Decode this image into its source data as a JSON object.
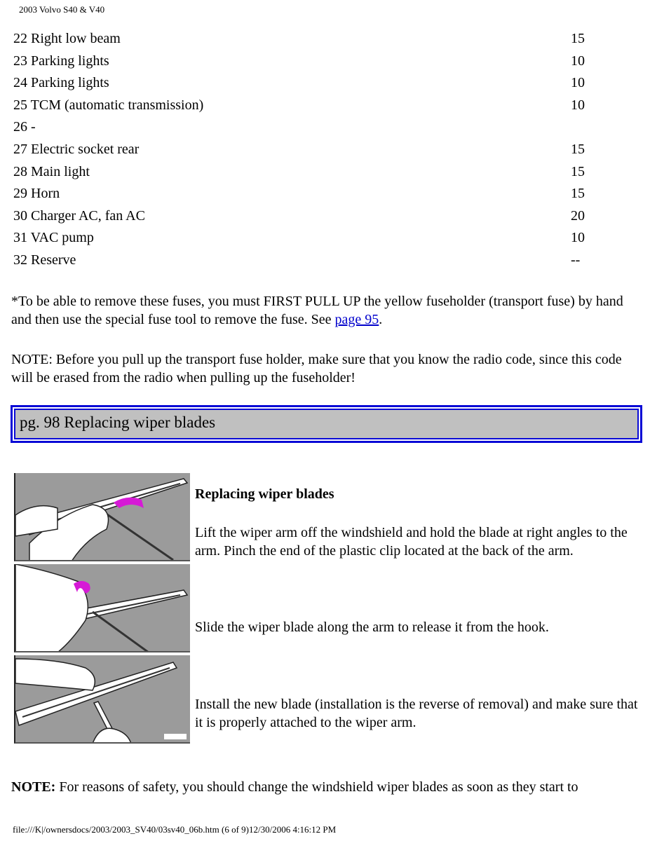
{
  "header": {
    "title": "2003 Volvo S40 & V40"
  },
  "fuses": [
    {
      "name": "22 Right low beam",
      "amp": "15"
    },
    {
      "name": "23 Parking lights",
      "amp": "10"
    },
    {
      "name": "24 Parking lights",
      "amp": "10"
    },
    {
      "name": "25 TCM (automatic transmission)",
      "amp": "10"
    },
    {
      "name": "26 -",
      "amp": ""
    },
    {
      "name": "27 Electric socket rear",
      "amp": "15"
    },
    {
      "name": "28 Main light",
      "amp": "15"
    },
    {
      "name": "29 Horn",
      "amp": "15"
    },
    {
      "name": "30 Charger AC, fan AC",
      "amp": "20"
    },
    {
      "name": "31 VAC pump",
      "amp": "10"
    },
    {
      "name": "32 Reserve",
      "amp": "--"
    }
  ],
  "note1": {
    "text": "*To be able to remove these fuses, you must FIRST PULL UP the yellow fuseholder (transport fuse) by hand and then use the special fuse tool to remove the fuse. See ",
    "link": "page 95",
    "end": "."
  },
  "note2": "NOTE: Before you pull up the transport fuse holder, make sure that you know the radio code, since this code will be erased from the radio when pulling up the fuseholder!",
  "section": {
    "title": "pg. 98 Replacing wiper blades"
  },
  "wiper": {
    "heading": "Replacing wiper blades",
    "step1": "Lift the wiper arm off the windshield and hold the blade at right angles to the arm. Pinch the end of the plastic clip located at the back of the arm.",
    "step2": "Slide the wiper blade along the arm to release it from the hook.",
    "step3": "Install the new blade (installation is the reverse of removal) and make sure that it is properly attached to the wiper arm."
  },
  "final_note": {
    "label": "NOTE:",
    "text": " For reasons of safety, you should change the windshield wiper blades as soon as they start to"
  },
  "footer": "file:///K|/ownersdocs/2003/2003_SV40/03sv40_06b.htm (6 of 9)12/30/2006 4:16:12 PM"
}
